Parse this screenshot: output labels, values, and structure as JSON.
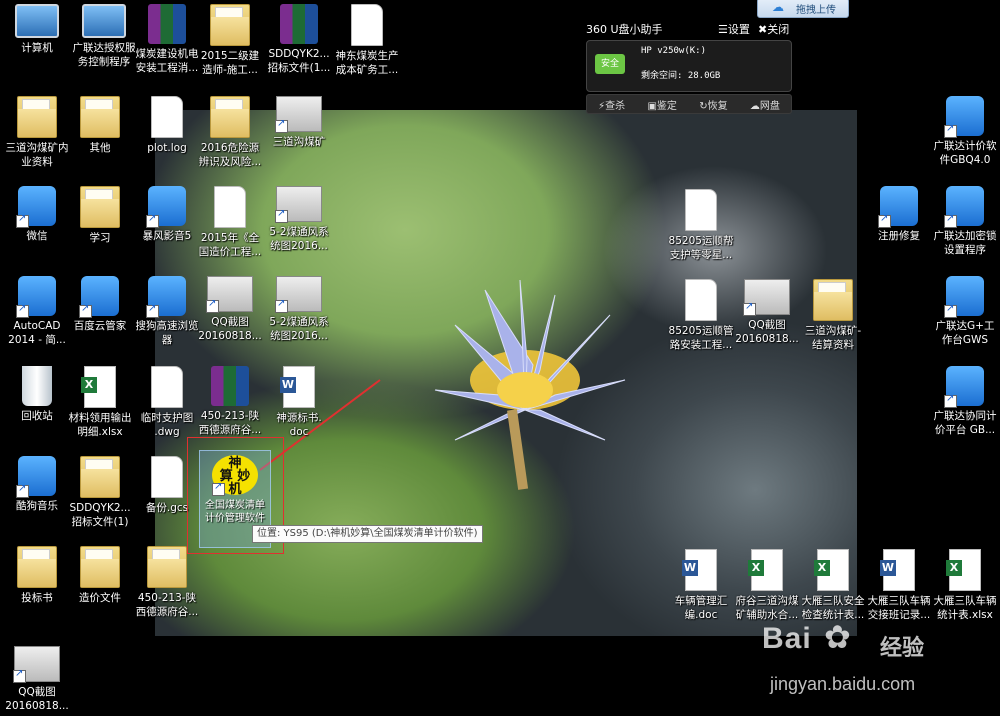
{
  "icons": [
    {
      "label": "计算机",
      "type": "computer"
    },
    {
      "label": "广联达授权服\n务控制程序",
      "type": "computer"
    },
    {
      "label": "煤炭建设机电\n安装工程消...",
      "type": "rar"
    },
    {
      "label": "2015二级建\n造师-施工...",
      "type": "folder"
    },
    {
      "label": "SDDQYK2...\n招标文件(1...",
      "type": "rar"
    },
    {
      "label": "神东煤炭生产\n成本矿务工...",
      "type": "doc"
    },
    {
      "label": "三道沟煤矿内\n业资料",
      "type": "folder"
    },
    {
      "label": "其他",
      "type": "folder"
    },
    {
      "label": "plot.log",
      "type": "doc"
    },
    {
      "label": "2016危险源\n辨识及风险...",
      "type": "folder"
    },
    {
      "label": "三道沟煤矿",
      "type": "shot"
    },
    {
      "label": "微信",
      "type": "app"
    },
    {
      "label": "学习",
      "type": "folder"
    },
    {
      "label": "暴风影音5",
      "type": "app"
    },
    {
      "label": "2015年《全\n国造价工程...",
      "type": "doc"
    },
    {
      "label": "5-2煤通风系\n统图2016...",
      "type": "shot"
    },
    {
      "label": "AutoCAD\n2014 - 简...",
      "type": "app"
    },
    {
      "label": "百度云管家",
      "type": "app"
    },
    {
      "label": "搜狗高速浏览\n器",
      "type": "app"
    },
    {
      "label": "QQ截图\n20160818...",
      "type": "shot"
    },
    {
      "label": "5-2煤通风系\n统图2016...",
      "type": "shot"
    },
    {
      "label": "回收站",
      "type": "bin"
    },
    {
      "label": "材料领用输出\n明细.xlsx",
      "type": "excel"
    },
    {
      "label": "临时支护图\n.dwg",
      "type": "doc"
    },
    {
      "label": "450-213-陕\n西德源府谷...",
      "type": "rar"
    },
    {
      "label": "神源标书.\ndoc",
      "type": "word"
    },
    {
      "label": "酷狗音乐",
      "type": "app"
    },
    {
      "label": "SDDQYK2...\n招标文件(1)",
      "type": "folder"
    },
    {
      "label": "备份.gcs",
      "type": "doc"
    },
    {
      "label": "投标书",
      "type": "folder"
    },
    {
      "label": "造价文件",
      "type": "folder"
    },
    {
      "label": "450-213-陕\n西德源府谷...",
      "type": "folder"
    },
    {
      "label": "QQ截图\n20160818...",
      "type": "shot"
    },
    {
      "label": "85205运顺帮\n支护等零星...",
      "type": "doc"
    },
    {
      "label": "85205运顺管\n路安装工程...",
      "type": "doc"
    },
    {
      "label": "QQ截图\n20160818...",
      "type": "shot"
    },
    {
      "label": "三道沟煤矿-\n结算资料",
      "type": "folder"
    },
    {
      "label": "车辆管理汇\n编.doc",
      "type": "word"
    },
    {
      "label": "府谷三道沟煤\n矿辅助水合...",
      "type": "excel"
    },
    {
      "label": "大雁三队安全\n检查统计表...",
      "type": "excel"
    },
    {
      "label": "大雁三队车辆\n交接班记录...",
      "type": "word"
    },
    {
      "label": "大雁三队车辆\n统计表.xlsx",
      "type": "excel"
    },
    {
      "label": "广联达计价软\n件GBQ4.0",
      "type": "app"
    },
    {
      "label": "注册修复",
      "type": "app"
    },
    {
      "label": "广联达加密锁\n设置程序",
      "type": "app"
    },
    {
      "label": "广联达G+工\n作台GWS",
      "type": "app"
    },
    {
      "label": "广联达协同计\n价平台 GB...",
      "type": "app"
    }
  ],
  "selected_icon": {
    "glyph": "神\n算 妙\n机",
    "label": "全国煤炭清单\n计价管理软件"
  },
  "tooltip": "位置: YS95 (D:\\神机妙算\\全国煤炭清单计价软件)",
  "u_disk": {
    "title": "360 U盘小助手",
    "settings": "设置",
    "close": "关闭",
    "safe_badge": "安全",
    "drive": "HP v250w(K:)",
    "free_space": "剩余空间: 28.0GB",
    "actions": [
      "查杀",
      "鉴定",
      "恢复",
      "网盘"
    ]
  },
  "upload_button": "拖拽上传",
  "watermark": {
    "logo": "Bai",
    "cn": "经验",
    "url": "jingyan.baidu.com"
  },
  "colors": {
    "highlight": "#e03030",
    "safe": "#6cc644",
    "desktop": "#000000"
  }
}
